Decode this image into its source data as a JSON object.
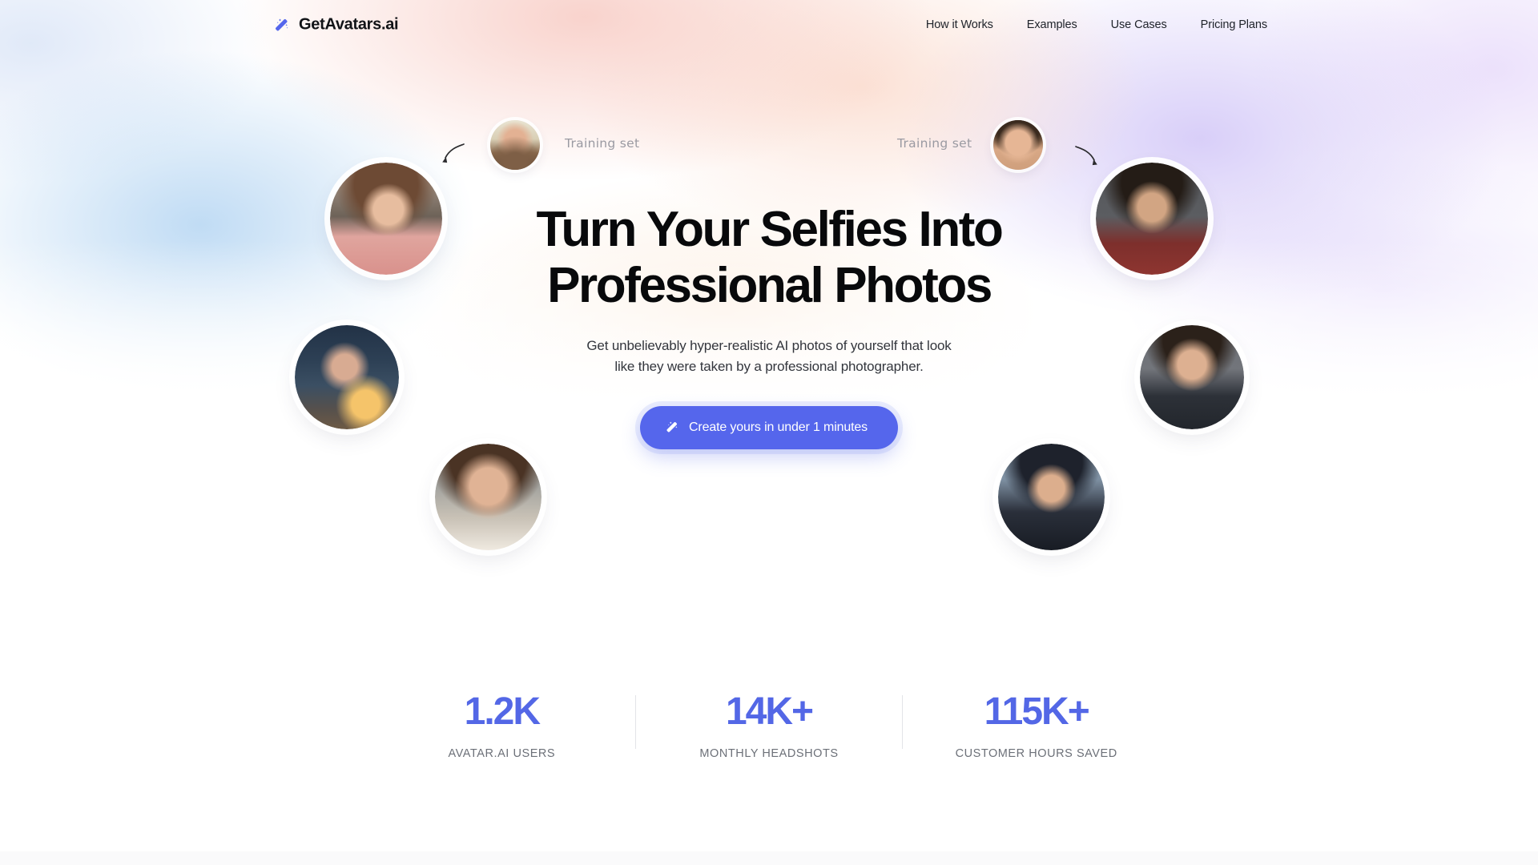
{
  "header": {
    "brand": {
      "name": "GetAvatars.ai",
      "icon": "magic-wand-icon",
      "color": "#5566ec"
    },
    "nav": [
      {
        "label": "How it Works"
      },
      {
        "label": "Examples"
      },
      {
        "label": "Use Cases"
      },
      {
        "label": "Pricing Plans"
      }
    ]
  },
  "hero": {
    "headline_line1": "Turn Your Selfies Into",
    "headline_line2": "Professional Photos",
    "subhead_line1": "Get unbelievably hyper-realistic AI photos of yourself that look",
    "subhead_line2": "like they were taken by a professional photographer.",
    "cta": {
      "label": "Create yours in under 1 minutes",
      "icon": "magic-wand-icon",
      "color": "#5566ec"
    },
    "training_label_left": "Training set",
    "training_label_right": "Training set",
    "arrow_left": "curved-arrow-left-icon",
    "arrow_right": "curved-arrow-right-icon"
  },
  "stats": {
    "accent_color": "#5367e6",
    "items": [
      {
        "value": "1.2K",
        "label": "AVATAR.AI USERS"
      },
      {
        "value": "14K+",
        "label": "MONTHLY HEADSHOTS"
      },
      {
        "value": "115K+",
        "label": "CUSTOMER HOURS SAVED"
      }
    ]
  }
}
